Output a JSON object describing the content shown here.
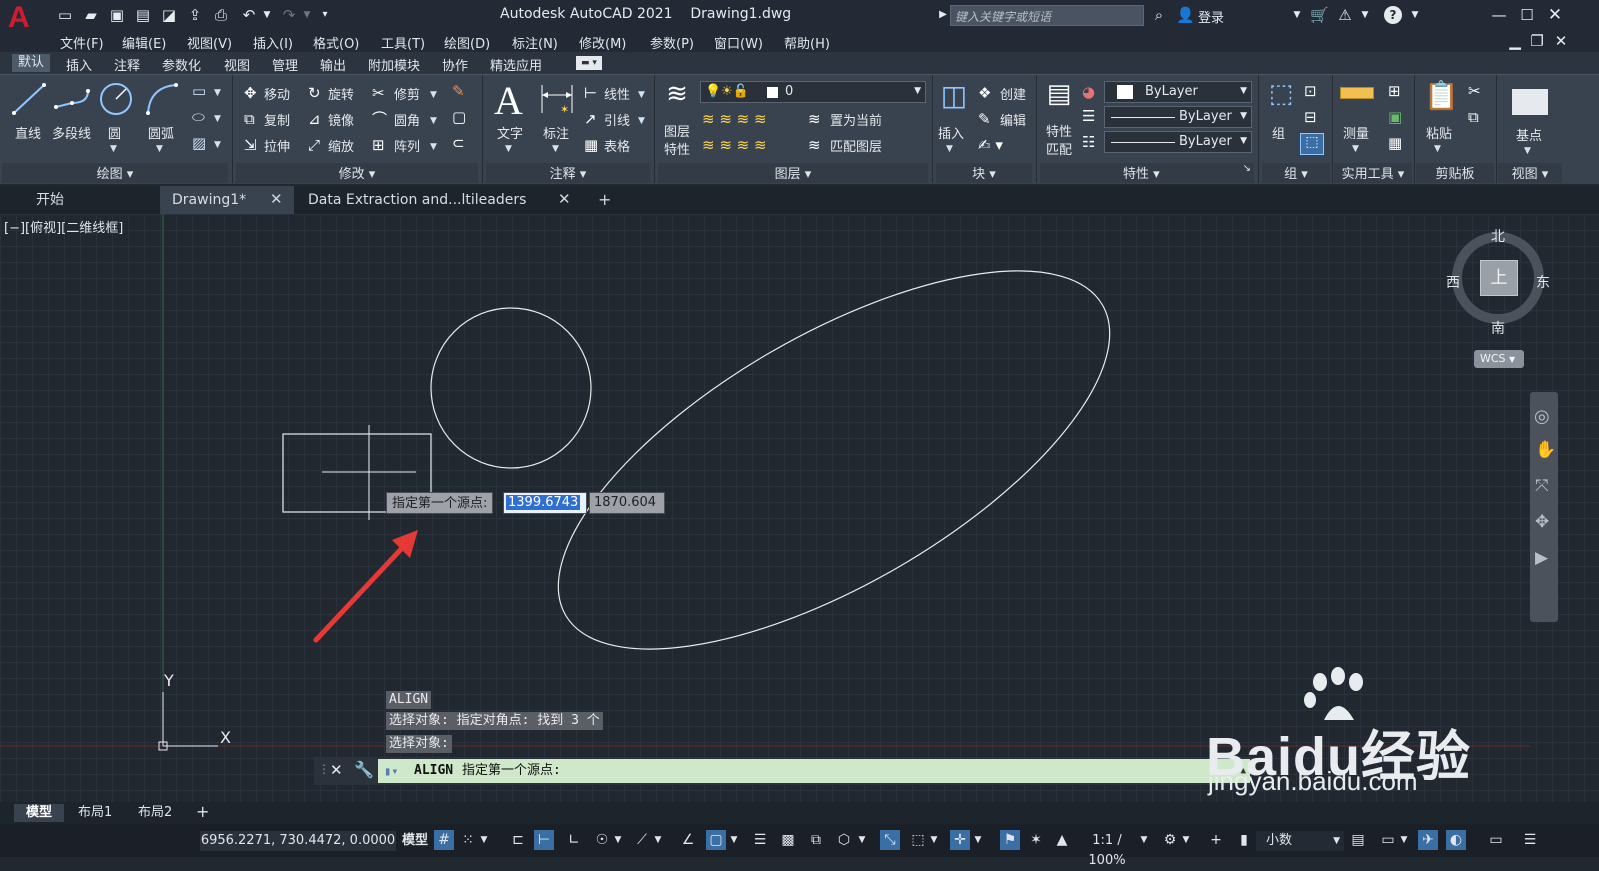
{
  "app": {
    "title": "Autodesk AutoCAD 2021    Drawing1.dwg",
    "search_placeholder": "键入关键字或短语",
    "login": "登录",
    "logo_letter": "A"
  },
  "menu": [
    "文件(F)",
    "编辑(E)",
    "视图(V)",
    "插入(I)",
    "格式(O)",
    "工具(T)",
    "绘图(D)",
    "标注(N)",
    "修改(M)",
    "参数(P)",
    "窗口(W)",
    "帮助(H)"
  ],
  "ribbon_tabs": [
    "默认",
    "插入",
    "注释",
    "参数化",
    "视图",
    "管理",
    "输出",
    "附加模块",
    "协作",
    "精选应用"
  ],
  "panels": {
    "draw": {
      "title": "绘图",
      "line": "直线",
      "polyline": "多段线",
      "circle": "圆",
      "arc": "圆弧"
    },
    "modify": {
      "title": "修改",
      "move": "移动",
      "rotate": "旋转",
      "trim": "修剪",
      "copy": "复制",
      "mirror": "镜像",
      "fillet": "圆角",
      "stretch": "拉伸",
      "scale": "缩放",
      "array": "阵列"
    },
    "annotation": {
      "title": "注释",
      "text": "文字",
      "dimension": "标注",
      "linear": "线性",
      "leader": "引线",
      "table": "表格"
    },
    "layers": {
      "title": "图层",
      "layer_props": "图层\n特性",
      "layer_props_1": "图层",
      "layer_props_2": "特性",
      "current_layer": "0",
      "set_current": "置为当前",
      "match_layer": "匹配图层"
    },
    "block": {
      "title": "块",
      "insert": "插入",
      "create": "创建",
      "edit": "编辑"
    },
    "properties": {
      "title": "特性",
      "match_1": "特性",
      "match_2": "匹配",
      "color": "ByLayer",
      "linetype": "ByLayer",
      "lineweight": "ByLayer"
    },
    "groups": {
      "title": "组",
      "group": "组"
    },
    "utilities": {
      "title": "实用工具",
      "measure": "测量"
    },
    "clipboard": {
      "title": "剪贴板",
      "paste": "粘贴"
    },
    "view": {
      "title": "视图",
      "base": "基点"
    }
  },
  "doc_tabs": [
    "开始",
    "Drawing1*",
    "Data Extraction and...ltileaders Sample*"
  ],
  "viewport_label": "[−][俯视][二维线框]",
  "viewcube": {
    "north": "北",
    "south": "南",
    "west": "西",
    "east": "东",
    "top": "上",
    "wcs": "WCS"
  },
  "dynamic_input": {
    "prompt": "指定第一个源点:",
    "x": "1399.6743",
    "y": "1870.604"
  },
  "command_history": [
    "ALIGN",
    "选择对象: 指定对角点: 找到 3 个",
    "选择对象:"
  ],
  "command_line": {
    "command": "ALIGN",
    "prompt": "指定第一个源点:"
  },
  "ucs": {
    "y": "Y",
    "x": "X"
  },
  "layout_tabs": [
    "模型",
    "布局1",
    "布局2"
  ],
  "status": {
    "coords": "6956.2271, 730.4472, 0.0000",
    "model": "模型",
    "scale": "1:1 / 100%",
    "units": "小数"
  },
  "watermark": {
    "brand": "Baidu经验",
    "url": "jingyan.baidu.com"
  },
  "colors": {
    "accent": "#3a6fa6",
    "canvas": "#212830",
    "cmd_bg": "#cfe8c9",
    "arrow": "#e53935",
    "logo": "#c8102e"
  }
}
